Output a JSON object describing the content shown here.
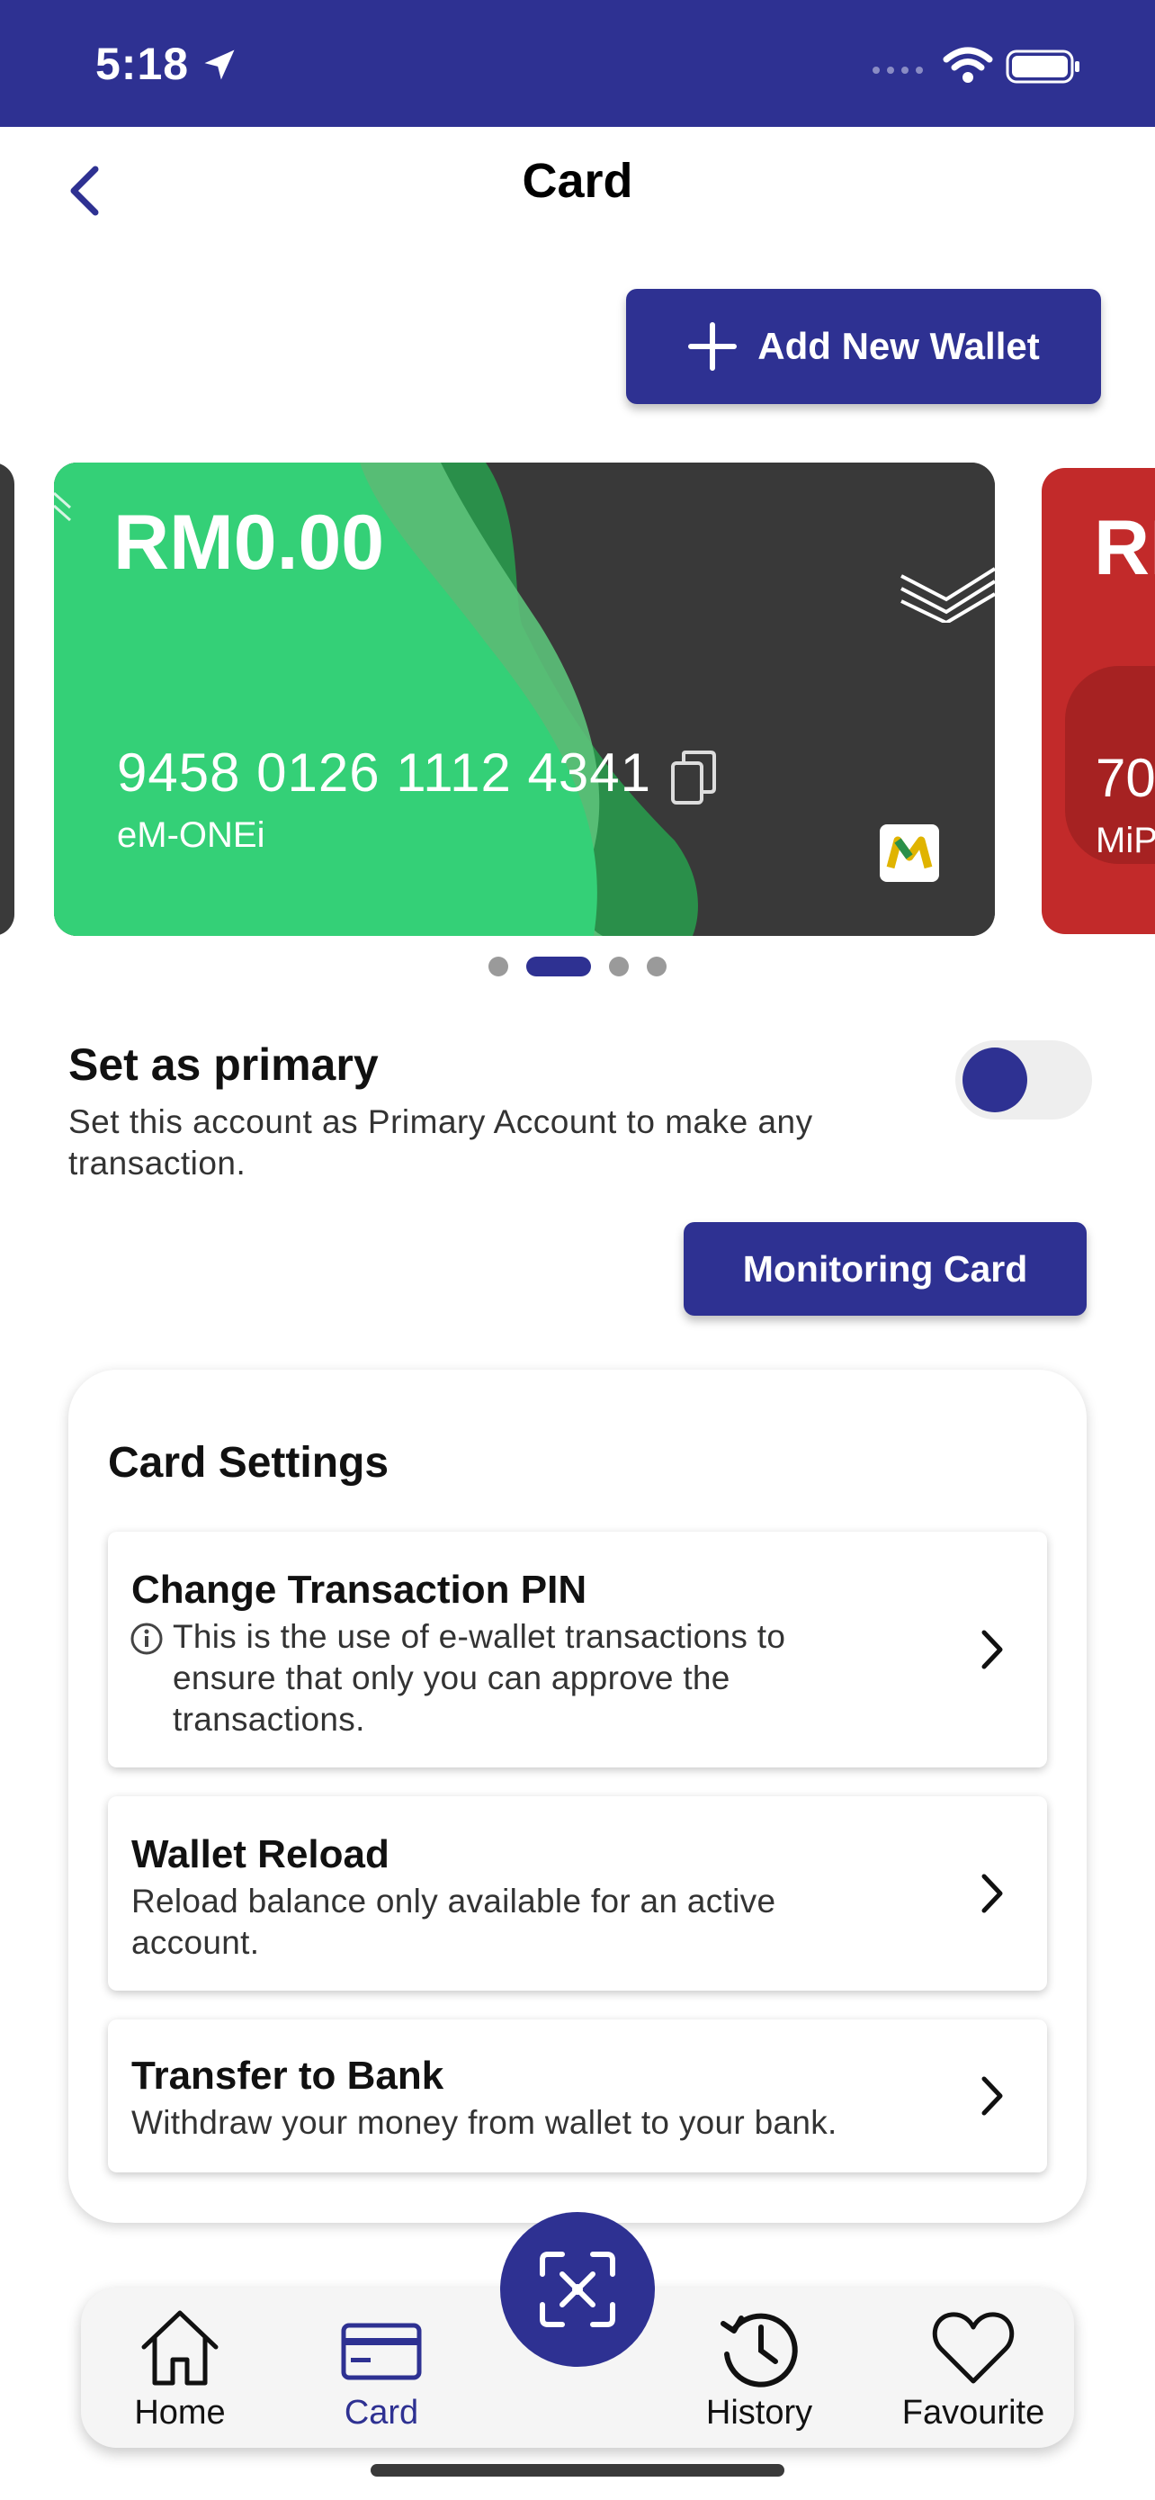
{
  "status_bar": {
    "time": "5:18",
    "background": "#2e3192"
  },
  "header": {
    "title": "Card"
  },
  "actions": {
    "add_wallet_label": "Add New Wallet"
  },
  "card": {
    "balance": "RM0.00",
    "number": "9458 0126 1112 4341",
    "name": "eM-ONEi",
    "colors": {
      "green": "#34d077",
      "dark": "#393939"
    }
  },
  "next_card": {
    "balance": "RI",
    "number": "70",
    "name": "MiP",
    "color": "#c22a2a"
  },
  "carousel": {
    "page_count": 4,
    "active_index": 1
  },
  "primary": {
    "title": "Set as primary",
    "description": "Set this account as Primary Account to make any transaction.",
    "toggle_on": true
  },
  "monitoring_label": "Monitoring Card",
  "settings": {
    "title": "Card Settings",
    "items": [
      {
        "title": "Change Transaction PIN",
        "description": "This is the use of e-wallet transactions to ensure that only you can approve the transactions.",
        "has_info_icon": true
      },
      {
        "title": "Wallet Reload",
        "description": "Reload balance only available for an active account.",
        "has_info_icon": false
      },
      {
        "title": "Transfer to Bank",
        "description": "Withdraw your money from wallet to your bank.",
        "has_info_icon": false
      }
    ]
  },
  "tabs": [
    {
      "label": "Home",
      "icon": "home-icon"
    },
    {
      "label": "Card",
      "icon": "card-icon",
      "active": true
    },
    {
      "label": "History",
      "icon": "history-icon"
    },
    {
      "label": "Favourite",
      "icon": "heart-icon"
    }
  ],
  "scan_icon": "scan-icon",
  "accent_color": "#2e3192"
}
